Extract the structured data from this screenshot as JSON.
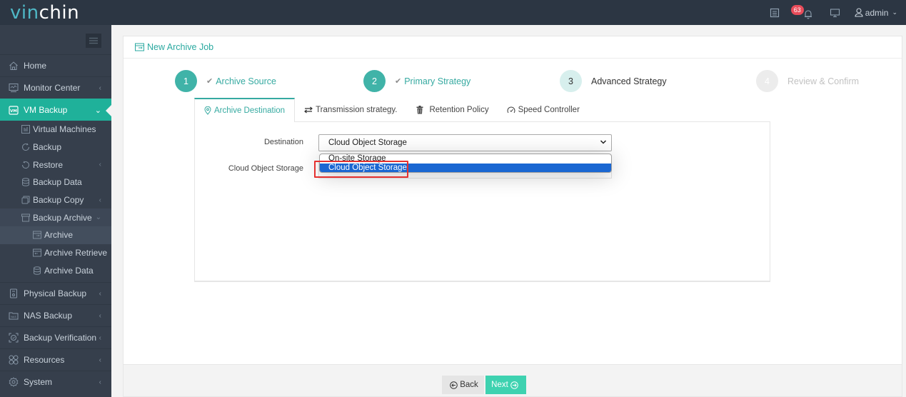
{
  "app": {
    "logo_part1": "vin",
    "logo_part2": "chin"
  },
  "topbar": {
    "notification_count": "63",
    "user_name": "admin",
    "icons": [
      "tasks-icon",
      "bell-icon",
      "monitor-icon",
      "user-icon"
    ]
  },
  "sidebar": {
    "items": [
      {
        "label": "Home",
        "icon": "home-icon"
      },
      {
        "label": "Monitor Center",
        "icon": "monitor-center-icon"
      },
      {
        "label": "VM Backup",
        "icon": "vm-icon",
        "active": true
      },
      {
        "label": "Physical Backup",
        "icon": "physical-icon"
      },
      {
        "label": "NAS Backup",
        "icon": "nas-icon"
      },
      {
        "label": "Backup Verification",
        "icon": "verification-icon"
      },
      {
        "label": "Resources",
        "icon": "resources-icon"
      },
      {
        "label": "System",
        "icon": "system-icon"
      }
    ],
    "vm_backup_sub": [
      {
        "label": "Virtual Machines"
      },
      {
        "label": "Backup"
      },
      {
        "label": "Restore"
      },
      {
        "label": "Backup Data"
      },
      {
        "label": "Backup Copy"
      },
      {
        "label": "Backup Archive"
      }
    ],
    "backup_archive_sub": [
      {
        "label": "Archive",
        "selected": true
      },
      {
        "label": "Archive Retrieve"
      },
      {
        "label": "Archive Data"
      }
    ]
  },
  "page": {
    "title": "New Archive Job"
  },
  "steps": [
    {
      "number": "1",
      "label": "Archive Source",
      "state": "done"
    },
    {
      "number": "2",
      "label": "Primary Strategy",
      "state": "done"
    },
    {
      "number": "3",
      "label": "Advanced Strategy",
      "state": "current"
    },
    {
      "number": "4",
      "label": "Review & Confirm",
      "state": "future"
    }
  ],
  "tabs": [
    {
      "label": "Archive Destination",
      "active": true
    },
    {
      "label": "Transmission strategy."
    },
    {
      "label": "Retention Policy"
    },
    {
      "label": "Speed Controller"
    }
  ],
  "form": {
    "destination_label": "Destination",
    "destination_value": "Cloud Object Storage",
    "cloud_storage_label": "Cloud Object Storage",
    "dropdown_options": [
      {
        "label": "On-site Storage"
      },
      {
        "label": "Cloud Object Storage",
        "selected": true
      }
    ]
  },
  "footer": {
    "back_label": "Back",
    "next_label": "Next"
  },
  "colors": {
    "accent": "#1fb19a",
    "step_done": "#40b3a8",
    "next_button": "#3ed2b0",
    "badge": "#e84c5a",
    "dropdown_selected": "#1a67d2",
    "highlight_box": "#e5312f"
  }
}
